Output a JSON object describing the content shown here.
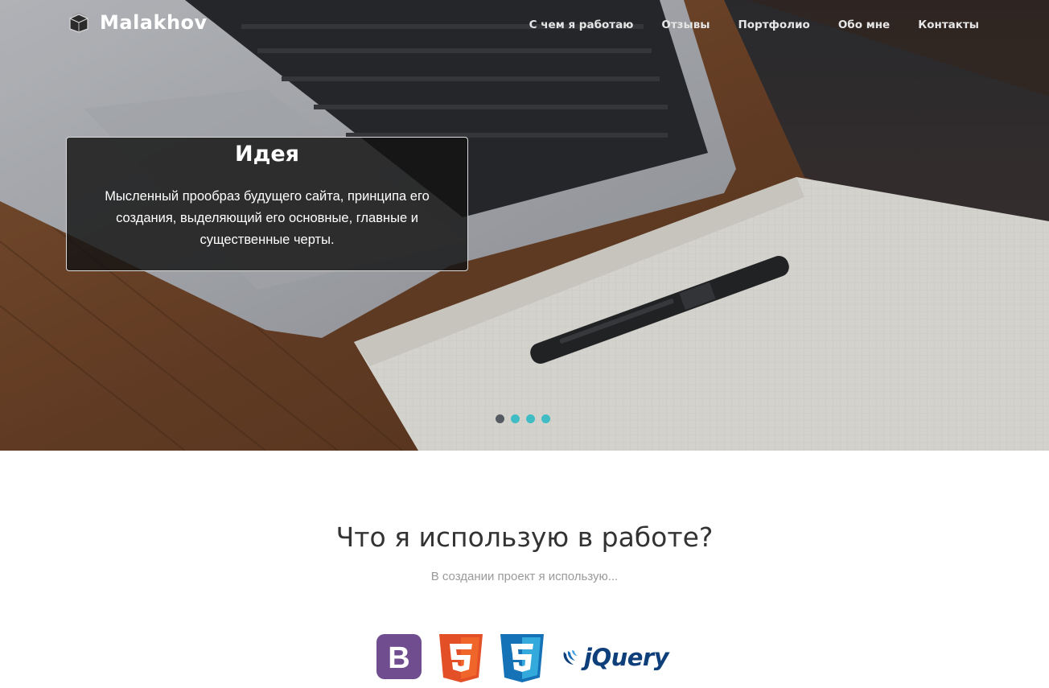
{
  "brand": {
    "name": "Malakhov",
    "icon": "tray-box-icon"
  },
  "nav": {
    "items": [
      {
        "label": "С чем я работаю"
      },
      {
        "label": "Отзывы"
      },
      {
        "label": "Портфолио"
      },
      {
        "label": "Обо мне"
      },
      {
        "label": "Контакты"
      }
    ]
  },
  "slider": {
    "caption": {
      "title": "Идея",
      "text": "Мысленный прообраз будущего сайта, принципа его создания, выделяющий его основные, главные и существенные черты."
    },
    "slide_count": 4,
    "active_slide": 1,
    "colors": {
      "dot_active": "#555b60",
      "dot_inactive": "#3fbcc4"
    }
  },
  "tools": {
    "title": "Что я использую в работе?",
    "subtitle": "В создании проект я использую...",
    "logos": [
      {
        "name": "bootstrap-logo-icon",
        "glyph": "B",
        "color": "#6f4d8f"
      },
      {
        "name": "html5-logo-icon",
        "glyph": "5",
        "color": "#e34f26"
      },
      {
        "name": "css3-logo-icon",
        "glyph": "3",
        "color": "#1572b6"
      },
      {
        "name": "jquery-logo-icon",
        "text": "jQuery",
        "color": "#0f3f7a"
      }
    ]
  }
}
